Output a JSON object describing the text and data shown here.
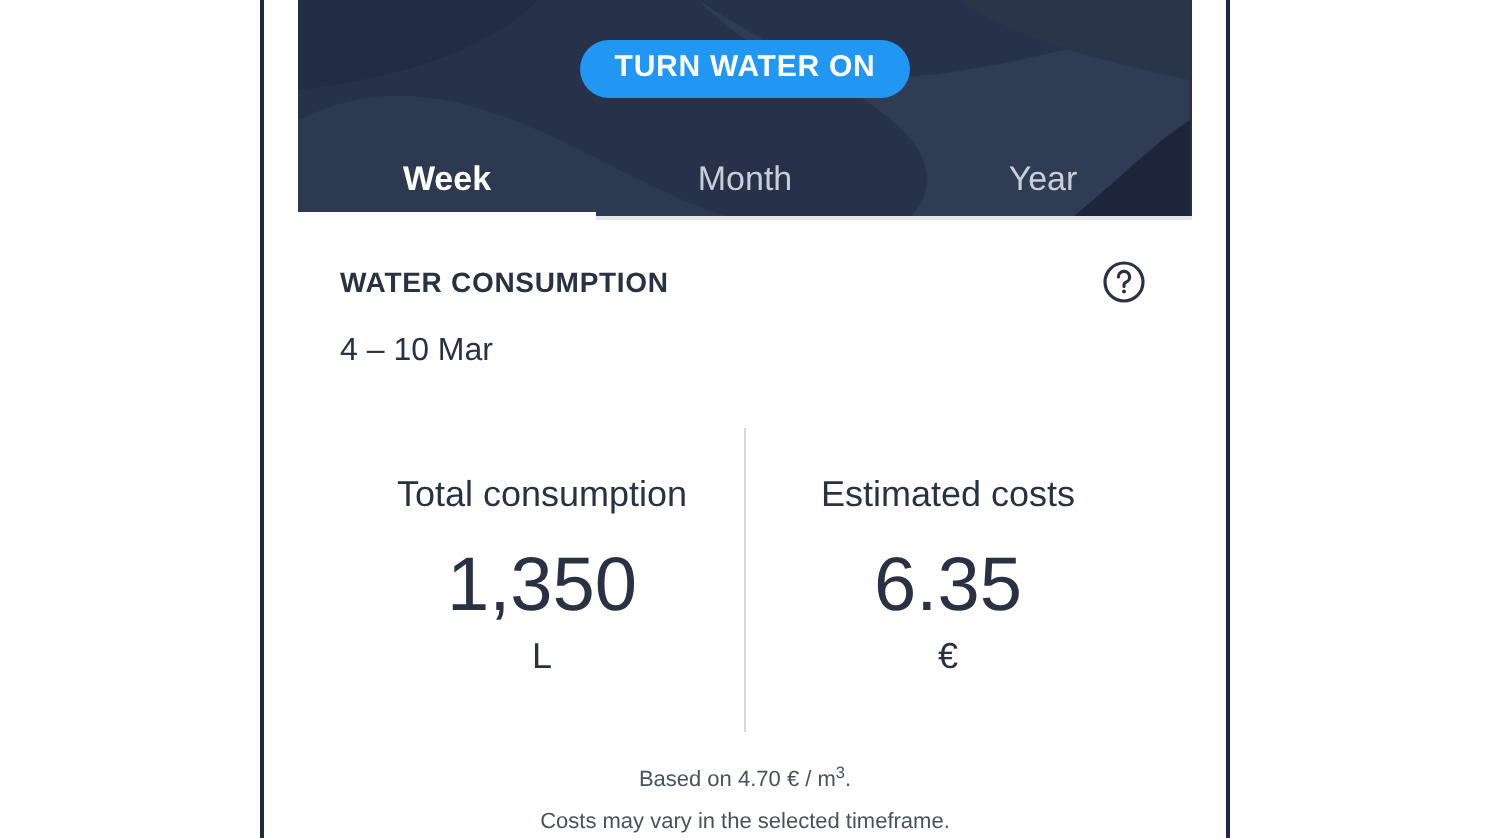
{
  "header": {
    "button": "TURN WATER ON"
  },
  "tabs": [
    {
      "label": "Week",
      "selected": true
    },
    {
      "label": "Month",
      "selected": false
    },
    {
      "label": "Year",
      "selected": false
    }
  ],
  "card": {
    "title": "WATER CONSUMPTION",
    "date_range": "4 – 10 Mar",
    "stats": [
      {
        "label": "Total consumption",
        "value": "1,350",
        "unit": "L"
      },
      {
        "label": "Estimated costs",
        "value": "6.35",
        "unit": "€"
      }
    ],
    "notes": [
      "Based on 4.70 € / m$^{3}$.",
      "Costs may vary in the selected timeframe."
    ]
  }
}
